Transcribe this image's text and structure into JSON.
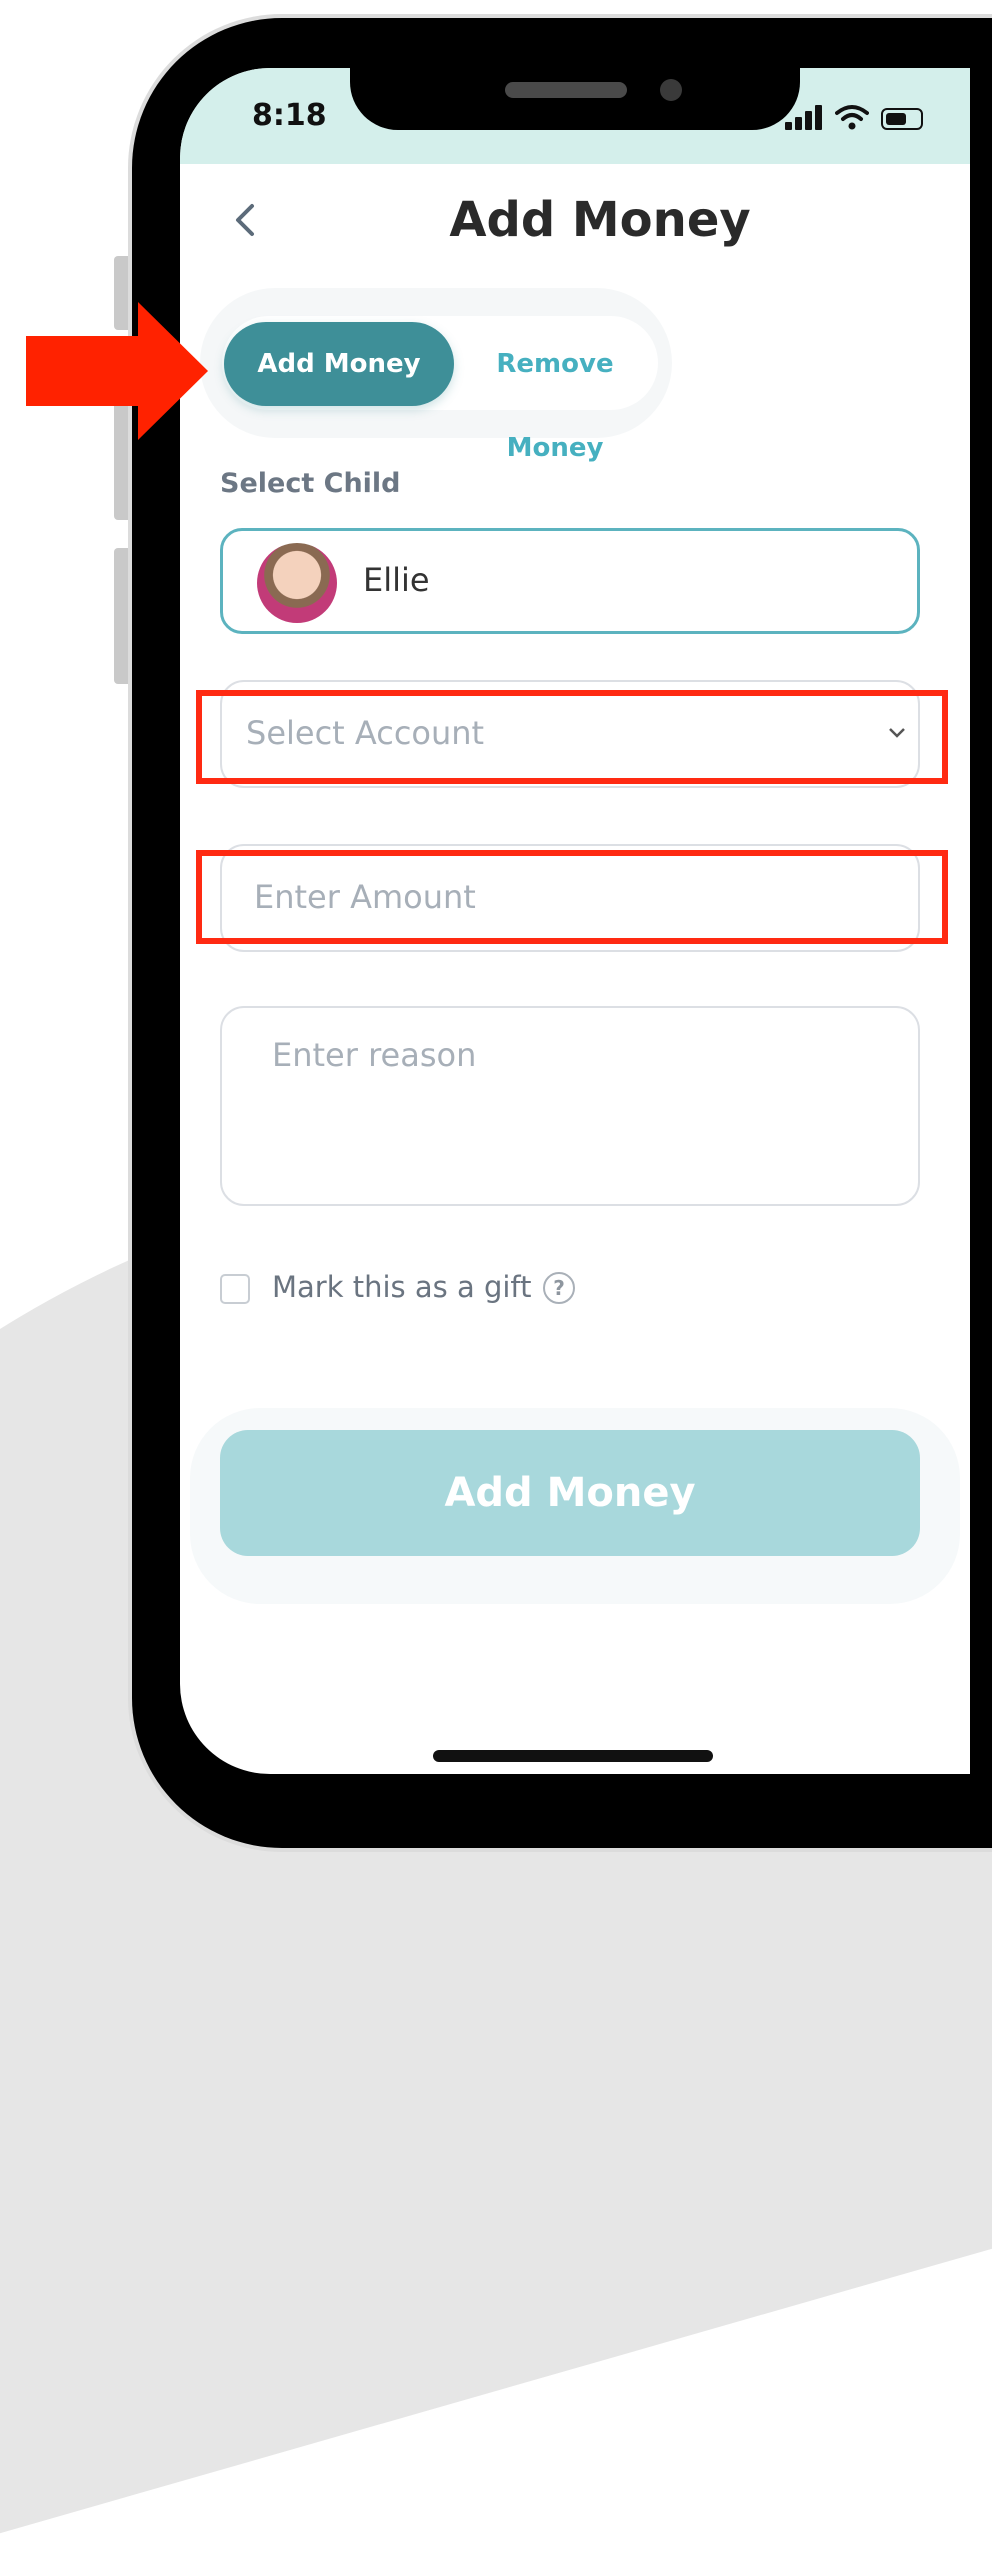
{
  "status_bar": {
    "time": "8:18"
  },
  "header": {
    "title": "Add Money"
  },
  "mode_toggle": {
    "active": "Add Money",
    "inactive": "Remove Money"
  },
  "child_section": {
    "label": "Select Child",
    "selected_child": "Ellie"
  },
  "account_select": {
    "placeholder": "Select Account"
  },
  "amount_input": {
    "placeholder": "Enter Amount"
  },
  "reason_input": {
    "placeholder": "Enter reason"
  },
  "gift": {
    "label": "Mark this as a gift",
    "checked": false,
    "help_glyph": "?"
  },
  "submit": {
    "label": "Add Money"
  },
  "colors": {
    "accent": "#3e8f98",
    "accent_text": "#46b0c0",
    "submit_disabled": "#a8d8dc",
    "status_bar": "#d4efeb",
    "annotation": "#ff2a12"
  }
}
